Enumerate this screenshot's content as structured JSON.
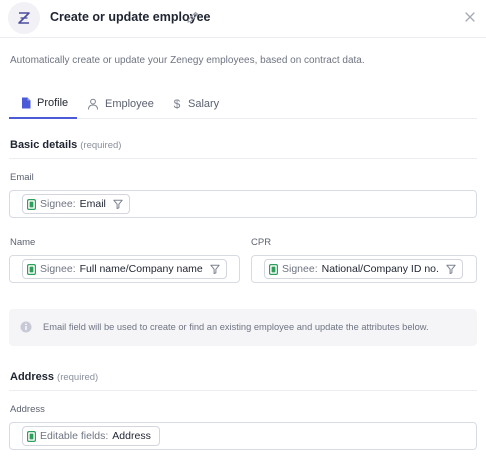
{
  "header": {
    "title": "Create or update employee"
  },
  "description": "Automatically create or update your Zenegy employees, based on contract data.",
  "tabs": [
    {
      "label": "Profile",
      "active": true,
      "icon": "document-icon"
    },
    {
      "label": "Employee",
      "active": false,
      "icon": "person-icon"
    },
    {
      "label": "Salary",
      "active": false,
      "icon": "dollar-icon"
    }
  ],
  "basic_details": {
    "title": "Basic details",
    "required": "(required)",
    "email": {
      "label": "Email",
      "chip_prefix": "Signee:",
      "chip_value": "Email"
    },
    "name": {
      "label": "Name",
      "chip_prefix": "Signee:",
      "chip_value": "Full name/Company name"
    },
    "cpr": {
      "label": "CPR",
      "chip_prefix": "Signee:",
      "chip_value": "National/Company ID no."
    }
  },
  "info": {
    "text": "Email field will be used to create or find an existing employee and update the attributes below."
  },
  "address": {
    "title": "Address",
    "required": "(required)",
    "field": {
      "label": "Address",
      "chip_prefix": "Editable fields:",
      "chip_value": "Address"
    }
  },
  "colors": {
    "accent": "#4b5bd8",
    "chip_icon": "#2e9e5a"
  }
}
